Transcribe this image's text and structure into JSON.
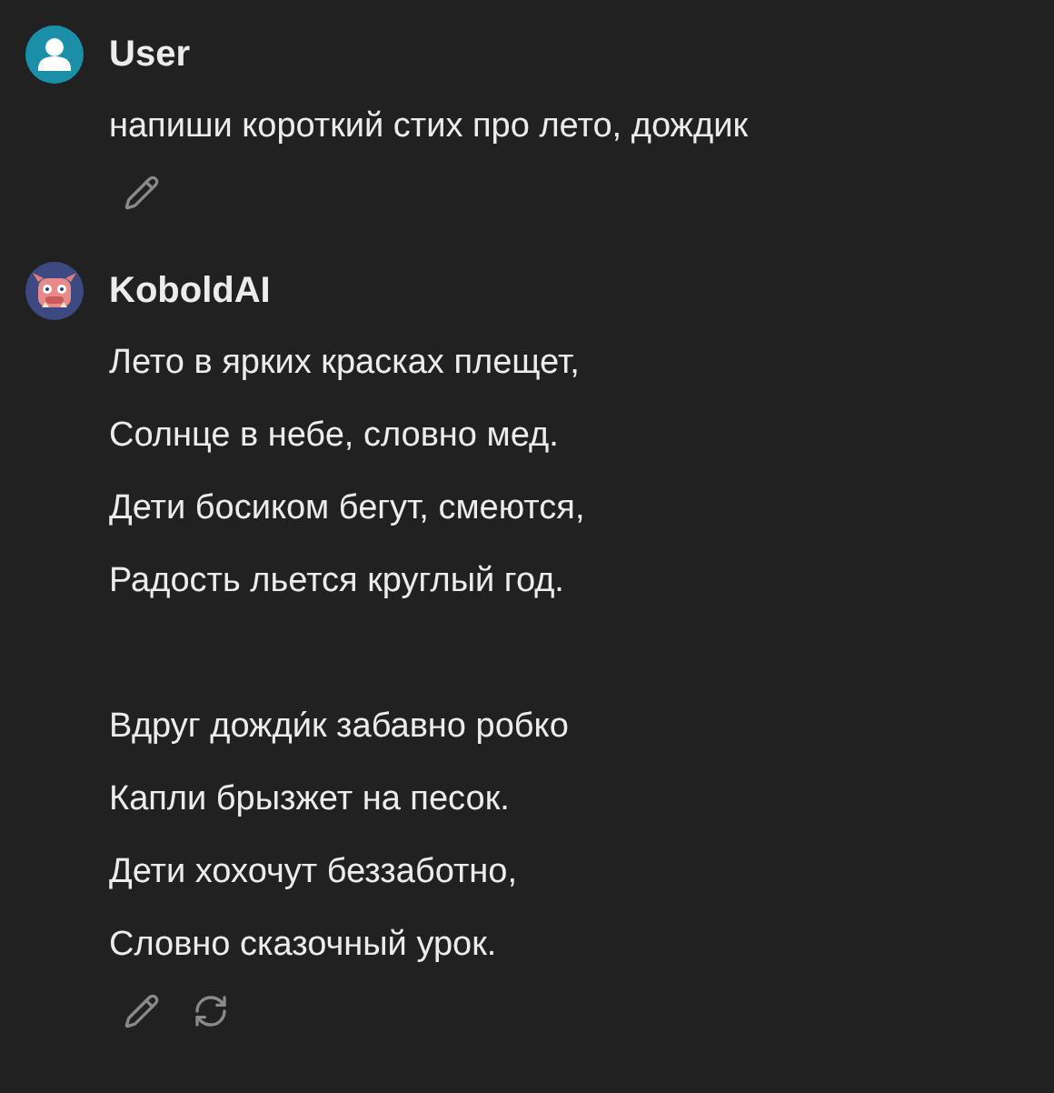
{
  "messages": [
    {
      "author": "User",
      "kind": "user",
      "stanzas": [
        [
          "напиши короткий стих про лето, дождик"
        ]
      ],
      "actions": [
        {
          "kind": "edit"
        }
      ]
    },
    {
      "author": "KoboldAI",
      "kind": "kobold",
      "stanzas": [
        [
          "Лето в ярких красках плещет,",
          "Солнце в небе, словно мед.",
          "Дети босиком бегут, смеются,",
          "Радость льется круглый год."
        ],
        [
          "Вдруг дожди́к забавно робко",
          "Капли брызжет на песок.",
          "Дети хохочут беззаботно,",
          "Словно сказочный урок."
        ]
      ],
      "actions": [
        {
          "kind": "edit"
        },
        {
          "kind": "regenerate"
        }
      ]
    }
  ]
}
